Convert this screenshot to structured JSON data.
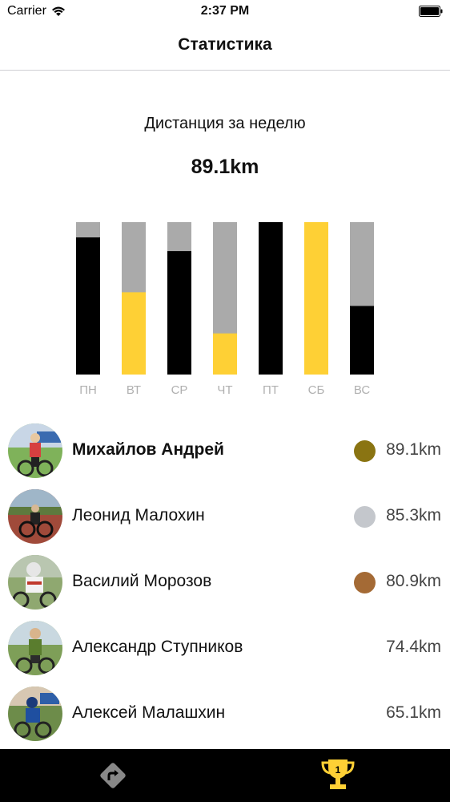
{
  "status_bar": {
    "carrier": "Carrier",
    "time": "2:37 PM"
  },
  "nav": {
    "title": "Статистика"
  },
  "summary": {
    "label": "Дистанция за неделю",
    "total": "89.1km"
  },
  "colors": {
    "accent": "#fed035",
    "filled_dark": "#000000",
    "remaining": "#aaaaaa",
    "gold": "#8a7412",
    "silver": "#c4c7cc",
    "bronze": "#a46a35"
  },
  "chart_data": {
    "type": "bar",
    "categories": [
      "ПН",
      "ВТ",
      "СР",
      "ЧТ",
      "ПТ",
      "СБ",
      "ВС"
    ],
    "values": [
      0.9,
      0.54,
      0.81,
      0.27,
      1.0,
      1.0,
      0.45
    ],
    "highlight": [
      false,
      true,
      false,
      true,
      false,
      true,
      false
    ],
    "ylim": [
      0,
      1
    ]
  },
  "leaderboard": [
    {
      "name": "Михайлов Андрей",
      "distance": "89.1km",
      "medal": "gold",
      "bold": true
    },
    {
      "name": "Леонид Малохин",
      "distance": "85.3km",
      "medal": "silver",
      "bold": false
    },
    {
      "name": "Василий Морозов",
      "distance": "80.9km",
      "medal": "bronze",
      "bold": false
    },
    {
      "name": "Александр Ступников",
      "distance": "74.4km",
      "medal": "",
      "bold": false
    },
    {
      "name": "Алексей Малашхин",
      "distance": "65.1km",
      "medal": "",
      "bold": false
    }
  ],
  "tab_bar": {
    "tabs": [
      {
        "icon": "route-sign-icon"
      },
      {
        "icon": "trophy-icon"
      }
    ]
  }
}
